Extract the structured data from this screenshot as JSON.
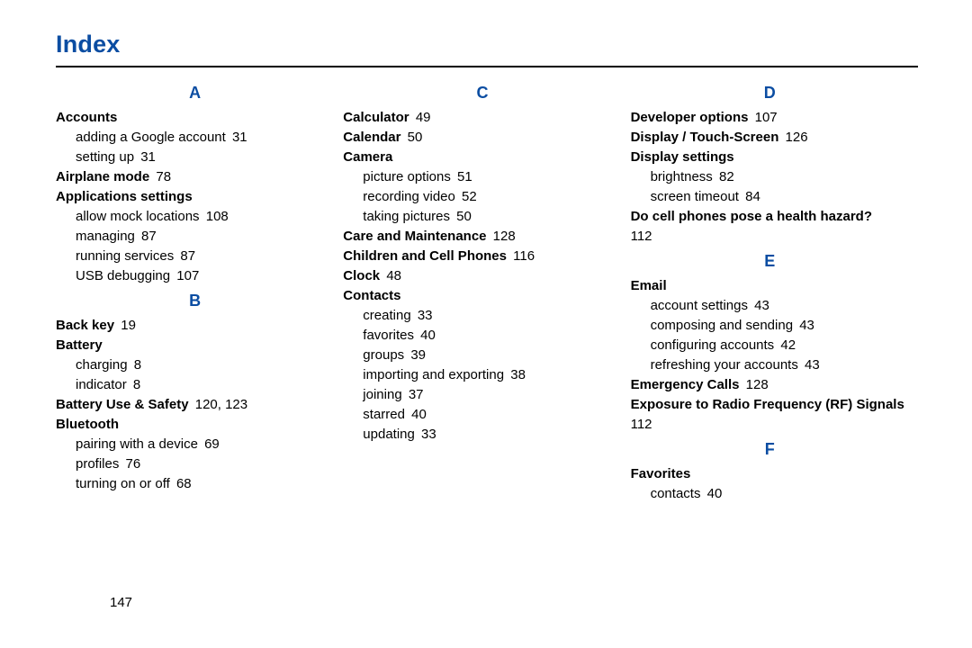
{
  "title": "Index",
  "page_number": "147",
  "columns": [
    {
      "sections": [
        {
          "letter": "A",
          "entries": [
            {
              "term": "Accounts",
              "subs": [
                {
                  "text": "adding a Google account",
                  "page": "31"
                },
                {
                  "text": "setting up",
                  "page": "31"
                }
              ]
            },
            {
              "term": "Airplane mode",
              "page": "78"
            },
            {
              "term": "Applications settings",
              "subs": [
                {
                  "text": "allow mock locations",
                  "page": "108"
                },
                {
                  "text": "managing",
                  "page": "87"
                },
                {
                  "text": "running services",
                  "page": "87"
                },
                {
                  "text": "USB debugging",
                  "page": "107"
                }
              ]
            }
          ]
        },
        {
          "letter": "B",
          "entries": [
            {
              "term": "Back key",
              "page": "19"
            },
            {
              "term": "Battery",
              "subs": [
                {
                  "text": "charging",
                  "page": "8"
                },
                {
                  "text": "indicator",
                  "page": "8"
                }
              ]
            },
            {
              "term": "Battery Use & Safety",
              "pages": [
                "120",
                "123"
              ]
            },
            {
              "term": "Bluetooth",
              "subs": [
                {
                  "text": "pairing with a device",
                  "page": "69"
                },
                {
                  "text": "profiles",
                  "page": "76"
                },
                {
                  "text": "turning on or off",
                  "page": "68"
                }
              ]
            }
          ]
        }
      ]
    },
    {
      "sections": [
        {
          "letter": "C",
          "entries": [
            {
              "term": "Calculator",
              "page": "49"
            },
            {
              "term": "Calendar",
              "page": "50"
            },
            {
              "term": "Camera",
              "subs": [
                {
                  "text": "picture options",
                  "page": "51"
                },
                {
                  "text": "recording video",
                  "page": "52"
                },
                {
                  "text": "taking pictures",
                  "page": "50"
                }
              ]
            },
            {
              "term": "Care and Maintenance",
              "page": "128"
            },
            {
              "term": "Children and Cell Phones",
              "page": "116"
            },
            {
              "term": "Clock",
              "page": "48"
            },
            {
              "term": "Contacts",
              "subs": [
                {
                  "text": "creating",
                  "page": "33"
                },
                {
                  "text": "favorites",
                  "page": "40"
                },
                {
                  "text": "groups",
                  "page": "39"
                },
                {
                  "text": "importing and exporting",
                  "page": "38"
                },
                {
                  "text": "joining",
                  "page": "37"
                },
                {
                  "text": "starred",
                  "page": "40"
                },
                {
                  "text": "updating",
                  "page": "33"
                }
              ]
            }
          ]
        }
      ]
    },
    {
      "sections": [
        {
          "letter": "D",
          "entries": [
            {
              "term": "Developer options",
              "page": "107"
            },
            {
              "term": "Display / Touch-Screen",
              "page": "126"
            },
            {
              "term": "Display settings",
              "subs": [
                {
                  "text": "brightness",
                  "page": "82"
                },
                {
                  "text": "screen timeout",
                  "page": "84"
                }
              ]
            },
            {
              "term": "Do cell phones pose a health hazard?",
              "page_on_newline": "112"
            }
          ]
        },
        {
          "letter": "E",
          "entries": [
            {
              "term": "Email",
              "subs": [
                {
                  "text": "account settings",
                  "page": "43"
                },
                {
                  "text": "composing and sending",
                  "page": "43"
                },
                {
                  "text": "configuring accounts",
                  "page": "42"
                },
                {
                  "text": "refreshing your accounts",
                  "page": "43"
                }
              ]
            },
            {
              "term": "Emergency Calls",
              "page": "128"
            },
            {
              "term": "Exposure to Radio Frequency (RF) Signals",
              "page": "112"
            }
          ]
        },
        {
          "letter": "F",
          "entries": [
            {
              "term": "Favorites",
              "subs": [
                {
                  "text": "contacts",
                  "page": "40"
                }
              ]
            }
          ]
        }
      ]
    }
  ]
}
